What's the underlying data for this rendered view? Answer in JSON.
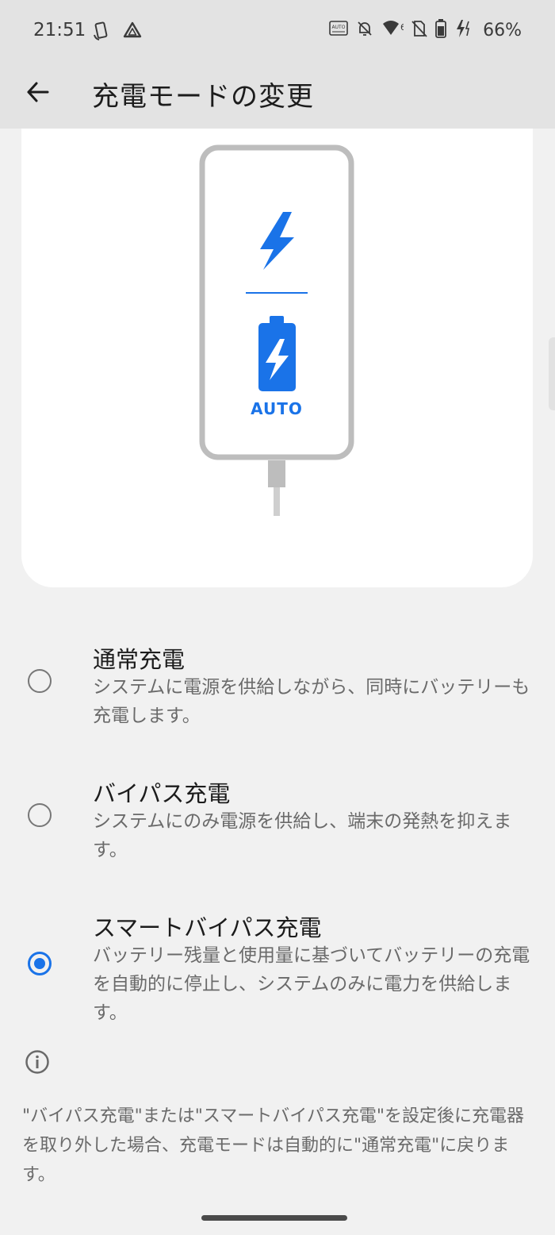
{
  "status_bar": {
    "time": "21:51",
    "battery_percent": "66%",
    "icons": [
      "screen-rotate-icon",
      "drive-icon",
      "auto-hz-icon",
      "bell-off-icon",
      "wifi-icon",
      "no-sim-icon",
      "battery-icon",
      "charging-icon"
    ],
    "auto_icon_label": "AUTO",
    "wifi_badge": "6"
  },
  "app_bar": {
    "title": "充電モードの変更",
    "back_icon": "arrow-back-icon"
  },
  "illustration": {
    "battery_label": "AUTO",
    "accent_color": "#1a73e8"
  },
  "options": [
    {
      "title": "通常充電",
      "description": "システムに電源を供給しながら、同時にバッテリーも充電します。",
      "selected": false
    },
    {
      "title": "バイパス充電",
      "description": "システムにのみ電源を供給し、端末の発熱を抑えます。",
      "selected": false
    },
    {
      "title": "スマートバイパス充電",
      "description": "バッテリー残量と使用量に基づいてバッテリーの充電を自動的に停止し、システムのみに電力を供給します。",
      "selected": true
    }
  ],
  "note": {
    "icon": "info-icon",
    "text": "\"バイパス充電\"または\"スマートバイパス充電\"を設定後に充電器を取り外した場合、充電モードは自動的に\"通常充電\"に戻ります。"
  }
}
